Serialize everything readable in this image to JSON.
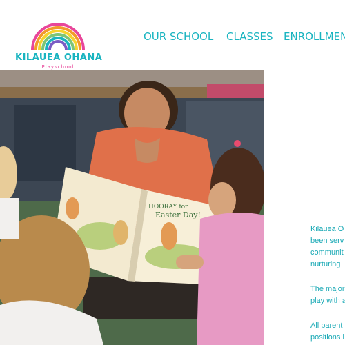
{
  "brand": {
    "name": "KILAUEA OHANA",
    "subtitle": "Playschool",
    "colors": {
      "teal": "#19b4c0",
      "pink": "#e8469a",
      "orange": "#f39a2b"
    }
  },
  "nav": {
    "items": [
      {
        "label": "OUR SCHOOL"
      },
      {
        "label": "CLASSES"
      },
      {
        "label": "ENROLLMENT"
      }
    ]
  },
  "hero": {
    "image_desc": "teacher-reading-book-to-children",
    "book_title_line1": "HOORAY for",
    "book_title_line2": "Easter Day!"
  },
  "about": {
    "paragraphs": [
      {
        "lines": [
          "Kilauea O",
          "been serv",
          "communit",
          "nurturing"
        ]
      },
      {
        "lines": [
          "The major",
          "play with a"
        ]
      },
      {
        "lines": [
          "All parent",
          "positions i"
        ]
      }
    ]
  }
}
